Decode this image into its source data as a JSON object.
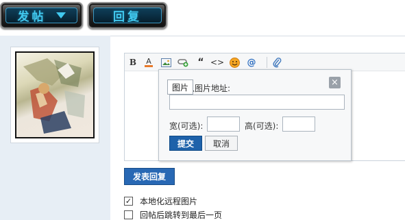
{
  "top_buttons": {
    "post_label": "发帖",
    "reply_label": "回复"
  },
  "toolbar": {
    "bold": "B",
    "font_color": "A",
    "image_icon": "image-icon",
    "link_icon": "link-icon",
    "quote": "“",
    "code": "<>",
    "smiley_icon": "smiley-icon",
    "mention": "@",
    "attach_icon": "paperclip-icon"
  },
  "image_popup": {
    "tab_label": "图片",
    "url_label": "入图片地址:",
    "url_value": "",
    "width_label": "宽(可选):",
    "width_value": "",
    "height_label": "高(可选):",
    "height_value": "",
    "submit_label": "提交",
    "cancel_label": "取消",
    "close_icon": "×"
  },
  "send_reply_label": "发表回复",
  "options": [
    {
      "label": "本地化远程图片",
      "checked": true
    },
    {
      "label": "回帖后跳转到最后一页",
      "checked": false
    }
  ],
  "colors": {
    "accent_blue": "#1e62aa",
    "sidebar_bg": "#e7eef5",
    "top_button_text": "#41c8ee"
  }
}
